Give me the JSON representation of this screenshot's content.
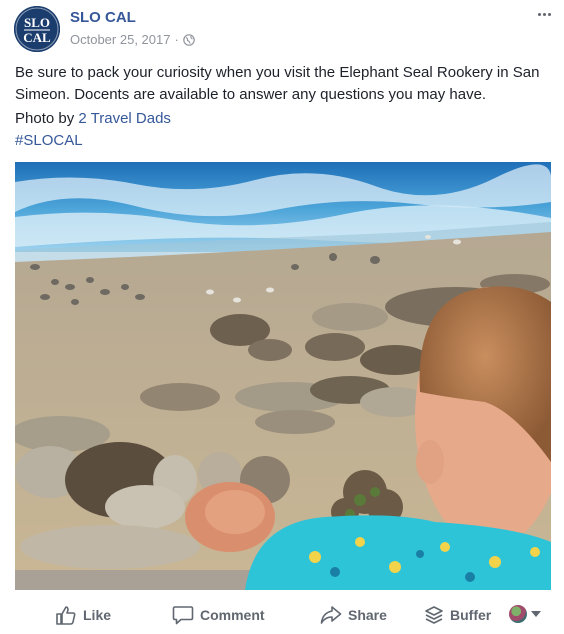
{
  "post": {
    "page_name": "SLO CAL",
    "date": "October 25, 2017",
    "date_separator": "·",
    "avatar_logo_text": [
      "SLO",
      "CAL"
    ],
    "text": "Be sure to pack your curiosity when you visit the Elephant Seal Rookery in San Simeon. Docents are available to answer any questions you may have.",
    "credit_prefix": "Photo by ",
    "credit_link": "2 Travel Dads",
    "hashtag": "#SLOCAL"
  },
  "icons": {
    "more": "more-options-icon",
    "privacy": "globe-icon",
    "like": "thumbs-up-icon",
    "comment": "comment-bubble-icon",
    "share": "share-arrow-icon",
    "buffer": "buffer-stack-icon"
  },
  "actions": {
    "like_label": "Like",
    "comment_label": "Comment",
    "share_label": "Share",
    "buffer_label": "Buffer"
  },
  "colors": {
    "link": "#365899",
    "muted": "#90949c",
    "action": "#606770",
    "text": "#1d2129",
    "avatar_bg": "#1b3d6e"
  }
}
